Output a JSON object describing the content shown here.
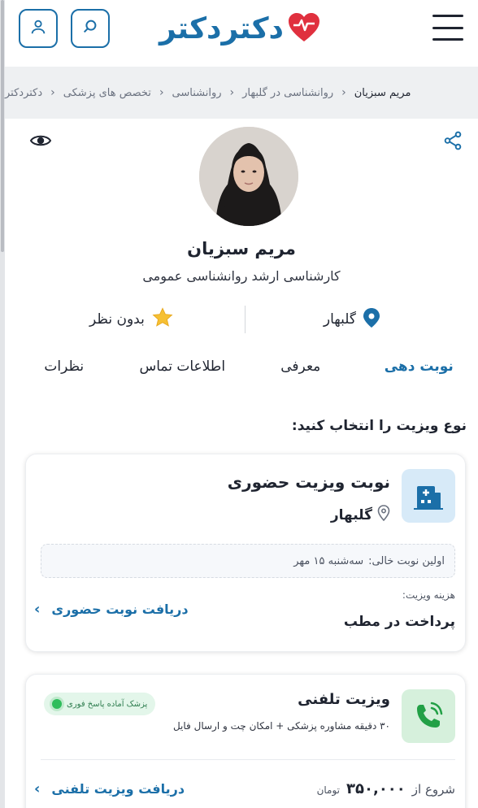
{
  "header": {
    "logo_text": "دکتردکتر",
    "icons": {
      "user": "user-icon",
      "search": "search-icon",
      "menu": "hamburger-menu-icon",
      "logo_heart": "heart-logo-icon"
    },
    "brand_color": "#1b6fa8",
    "logo_heart_color": "#e0303e"
  },
  "breadcrumb": {
    "items": [
      "دکتردکتر",
      "تخصص های پزشکی",
      "روانشناسی",
      "روانشناسی در گلبهار",
      "مریم سبزیان"
    ]
  },
  "profile": {
    "name": "مریم سبزیان",
    "specialty": "کارشناسی ارشد روانشناسی عمومی",
    "location": "گلبهار",
    "rating_text": "بدون نظر",
    "icons": {
      "share": "share-icon",
      "view": "eye-icon",
      "location": "location-pin-icon",
      "rating": "star-icon"
    }
  },
  "tabs": [
    {
      "label": "نوبت دهی",
      "active": true
    },
    {
      "label": "معرفی",
      "active": false
    },
    {
      "label": "اطلاعات تماس",
      "active": false
    },
    {
      "label": "نظرات",
      "active": false
    }
  ],
  "visit": {
    "heading": "نوع ویزیت را انتخاب کنید:",
    "in_person": {
      "title": "نوبت ویزیت حضوری",
      "location": "گلبهار",
      "first_slot_label": "اولین نوبت خالی:",
      "first_slot_value": "سه‌شنبه ۱۵ مهر",
      "fee_label": "هزینه ویزیت:",
      "fee_value": "پرداخت در مطب",
      "cta": "دریافت نوبت حضوری",
      "icon": "hospital-building-icon"
    },
    "phone": {
      "title": "ویزیت تلفنی",
      "badge": "پزشک آماده پاسخ فوری",
      "description": "۳۰ دقیقه مشاوره پزشکی + امکان چت و ارسال فایل",
      "price_from": "شروع از",
      "price_value": "۳۵۰,۰۰۰",
      "price_unit": "تومان",
      "cta": "دریافت ویزیت تلفنی",
      "icon": "phone-call-icon"
    }
  }
}
